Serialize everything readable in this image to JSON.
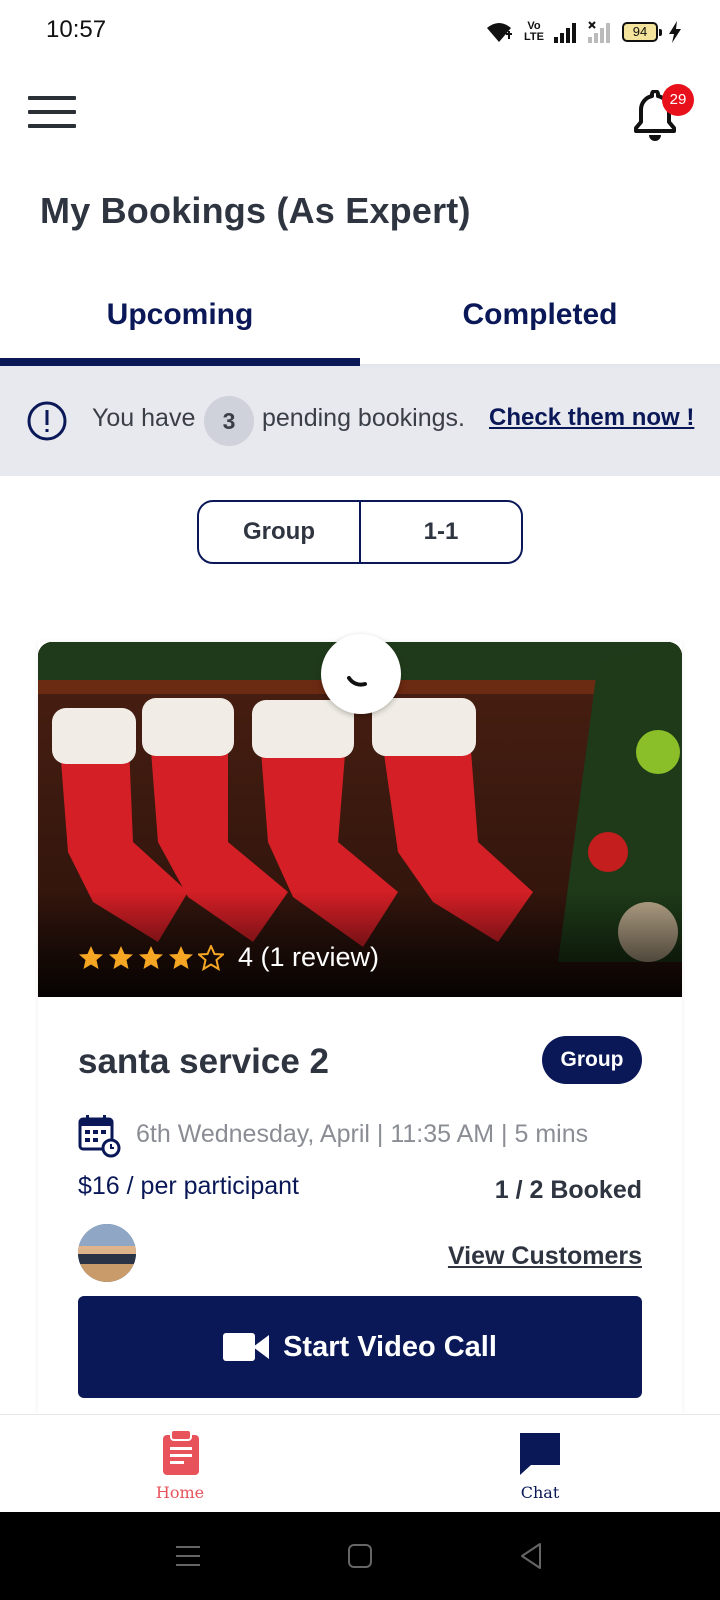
{
  "status_bar": {
    "time": "10:57",
    "volte_line1": "Vo",
    "volte_line2": "LTE",
    "battery": "94"
  },
  "header": {
    "notifications_count": "29",
    "page_title": "My Bookings (As Expert)"
  },
  "tabs": [
    {
      "label": "Upcoming",
      "active": true
    },
    {
      "label": "Completed",
      "active": false
    }
  ],
  "pending_banner": {
    "text_before": "You have",
    "count": "3",
    "text_after": "pending bookings.",
    "link": "Check them now !"
  },
  "segment": {
    "options": [
      "Group",
      "1-1"
    ]
  },
  "booking_card": {
    "rating_stars": 4,
    "rating_max": 5,
    "rating_text": "4 (1 review)",
    "title": "santa service 2",
    "type_badge": "Group",
    "session_info": "6th Wednesday, April | 11:35 AM | 5 mins",
    "price": "$16 / per participant",
    "booked": "1 / 2  Booked",
    "view_customers": "View Customers",
    "video_button": "Start Video Call"
  },
  "bottom_nav": {
    "items": [
      {
        "label": "Home",
        "icon": "clipboard-icon",
        "active": true
      },
      {
        "label": "Chat",
        "icon": "chat-bubble-icon",
        "active": false
      }
    ]
  },
  "colors": {
    "primary": "#0a1857",
    "badge_red": "#e8111b",
    "star": "#f5a623",
    "home_active": "#e8535b",
    "banner_bg": "#e8e9ef"
  }
}
